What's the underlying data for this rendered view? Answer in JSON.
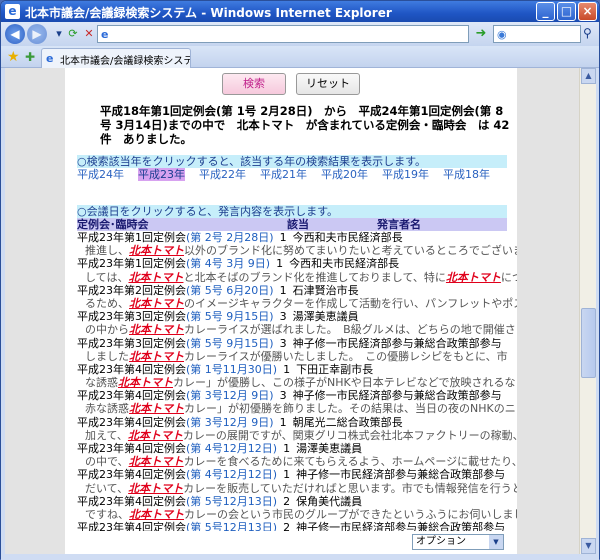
{
  "window": {
    "title": "北本市議会/会議録検索システム - Windows Internet Explorer",
    "minimize": "_",
    "maximize": "□",
    "close": "×"
  },
  "address_bar": {
    "url": "",
    "search_placeholder": ""
  },
  "tab": {
    "label": "北本市議会/会議録検索システム"
  },
  "buttons": {
    "search": "検索",
    "reset": "リセット"
  },
  "summary": "平成18年第1回定例会(第 1号 2月28日)　から　平成24年第1回定例会(第 8号 3月14日)までの中で　北本トマト　が含まれている定例会・臨時会　は 42件　ありました。",
  "year_section_head": "○検索該当年をクリックすると、該当する年の検索結果を表示します。",
  "years": [
    "平成24年",
    "平成23年",
    "平成22年",
    "平成21年",
    "平成20年",
    "平成19年",
    "平成18年"
  ],
  "selected_year": "平成23年",
  "date_section_head": "○会議日をクリックすると、発言内容を表示します。",
  "table_headers": {
    "meeting": "定例会･臨時会",
    "item": "該当",
    "speaker": "発言者名"
  },
  "keyword": "北本トマト",
  "results": [
    {
      "meeting": "平成23年第1回定例会",
      "date": "(第 2号 2月28日)",
      "item": "1",
      "speaker": "今西和夫市民経済部長",
      "pre": "推進し、",
      "post": "以外のブランド化に努めてまいりたいと考えているところでございます"
    },
    {
      "meeting": "平成23年第1回定例会",
      "date": "(第 4号 3月 9日)",
      "item": "1",
      "speaker": "今西和夫市民経済部長",
      "pre": "しては、",
      "post": "と北本そばのブランド化を推進しておりまして、特に",
      "post2": "につき"
    },
    {
      "meeting": "平成23年第2回定例会",
      "date": "(第 5号 6月20日)",
      "item": "1",
      "speaker": "石津賢治市長",
      "pre": "るため、",
      "post": "のイメージキャラクターを作成して活動を行い、パンフレットやポスタ"
    },
    {
      "meeting": "平成23年第3回定例会",
      "date": "(第 5号 9月15日)",
      "item": "3",
      "speaker": "湯澤美恵議員",
      "pre": "の中から",
      "post": "カレーライスが選ばれました。　B級グルメは、どちらの地で開催さ"
    },
    {
      "meeting": "平成23年第3回定例会",
      "date": "(第 5号 9月15日)",
      "item": "3",
      "speaker": "神子修一市民経済部参与兼総合政策部参与",
      "pre": "しました",
      "post": "カレーライスが優勝いたしました。　この優勝レシピをもとに、市"
    },
    {
      "meeting": "平成23年第4回定例会",
      "date": "(第 1号11月30日)",
      "item": "1",
      "speaker": "下田正幸副市長",
      "pre": "な誘惑",
      "post": "カレー」が優勝し、この様子がNHKや日本テレビなどで放映されるな"
    },
    {
      "meeting": "平成23年第4回定例会",
      "date": "(第 3号12月 9日)",
      "item": "3",
      "speaker": "神子修一市民経済部参与兼総合政策部参与",
      "pre": "赤な誘惑",
      "post": "カレー」が初優勝を飾りました。その結果は、当日の夜のNHKのニ"
    },
    {
      "meeting": "平成23年第4回定例会",
      "date": "(第 3号12月 9日)",
      "item": "1",
      "speaker": "朝尾光二総合政策部長",
      "pre": "加えて、",
      "post": "カレーの展開ですが、関東グリコ株式会社北本ファクトリーの稼動、"
    },
    {
      "meeting": "平成23年第4回定例会",
      "date": "(第 4号12月12日)",
      "item": "1",
      "speaker": "湯澤美恵議員",
      "pre": "の中で、",
      "post": "カレーを食べるために来てもらえるよう、ホームページに載せたり、グ"
    },
    {
      "meeting": "平成23年第4回定例会",
      "date": "(第 4号12月12日)",
      "item": "1",
      "speaker": "神子修一市民経済部参与兼総合政策部参与",
      "pre": "だいて、",
      "post": "カレーを販売していただければと思います。市でも情報発信を行うと"
    },
    {
      "meeting": "平成23年第4回定例会",
      "date": "(第 5号12月13日)",
      "item": "2",
      "speaker": "保角美代議員",
      "pre": "ですね、",
      "post": "カレーの会という市民のグループができたというふうにお伺いしました"
    },
    {
      "meeting": "平成23年第4回定例会",
      "date": "(第 5号12月13日)",
      "item": "2",
      "speaker": "神子修一市民経済部参与兼総合政策部参与",
      "pre": "赤な誘惑",
      "post": "カレー」が初優勝を飾り、日本テレビの朝の情報番組「スッキリ」など"
    }
  ],
  "option_select": "オプション",
  "colors": {
    "titlebar": "#1f55c4",
    "link": "#1f5fbf",
    "keyword": "#e0001b",
    "section_head": "#c6eefa",
    "table_head": "#cbc8f3",
    "selected_year": "#d7a2f0"
  },
  "icons": [
    "ie-icon",
    "back-icon",
    "forward-icon",
    "refresh-icon",
    "stop-icon",
    "go-icon",
    "search-icon",
    "favorites-star-icon",
    "add-favorite-icon"
  ]
}
